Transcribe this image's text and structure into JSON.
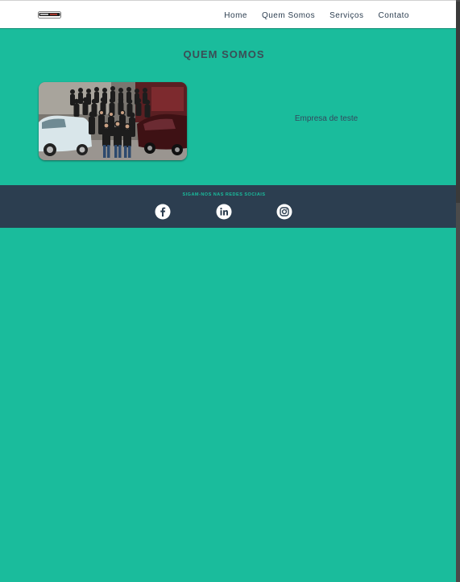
{
  "header": {
    "logo_alt": "StockCar",
    "nav": [
      {
        "label": "Home"
      },
      {
        "label": "Quem Somos"
      },
      {
        "label": "Serviços"
      },
      {
        "label": "Contato"
      }
    ]
  },
  "about": {
    "title": "QUEM SOMOS",
    "text": "Empresa de teste"
  },
  "footer": {
    "title": "SIGAM-NOS NAS REDES SOCIAIS",
    "social": [
      {
        "icon": "facebook-icon"
      },
      {
        "icon": "linkedin-icon"
      },
      {
        "icon": "instagram-icon"
      }
    ]
  },
  "colors": {
    "accent": "#1abc9c",
    "header_bg": "#ffffff",
    "footer_bg": "#2c3e50",
    "text_dark": "#2c3e50"
  }
}
